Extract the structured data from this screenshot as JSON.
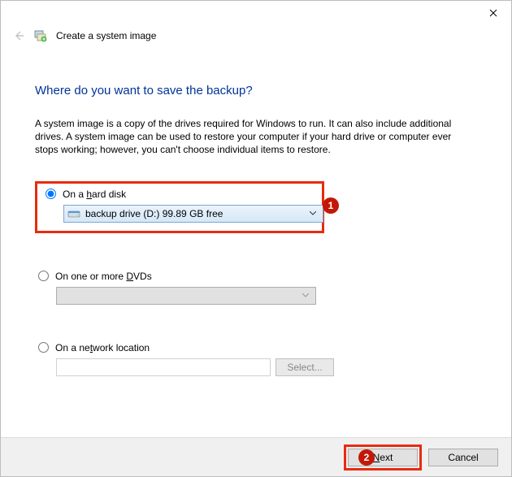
{
  "window": {
    "title": "Create a system image"
  },
  "page": {
    "heading": "Where do you want to save the backup?",
    "description": "A system image is a copy of the drives required for Windows to run. It can also include additional drives. A system image can be used to restore your computer if your hard drive or computer ever stops working; however, you can't choose individual items to restore."
  },
  "options": {
    "harddisk": {
      "label_pre": "On a ",
      "label_accel": "h",
      "label_post": "ard disk",
      "selected_drive": "backup drive (D:)  99.89 GB free",
      "checked": true
    },
    "dvd": {
      "label_pre": "On one or more ",
      "label_accel": "D",
      "label_post": "VDs",
      "checked": false
    },
    "network": {
      "label_pre": "On a ne",
      "label_accel": "t",
      "label_post": "work location",
      "checked": false,
      "path_value": "",
      "select_label": "Select..."
    }
  },
  "annotations": {
    "badge1": "1",
    "badge2": "2"
  },
  "buttons": {
    "next_accel": "N",
    "next_post": "ext",
    "cancel": "Cancel"
  }
}
